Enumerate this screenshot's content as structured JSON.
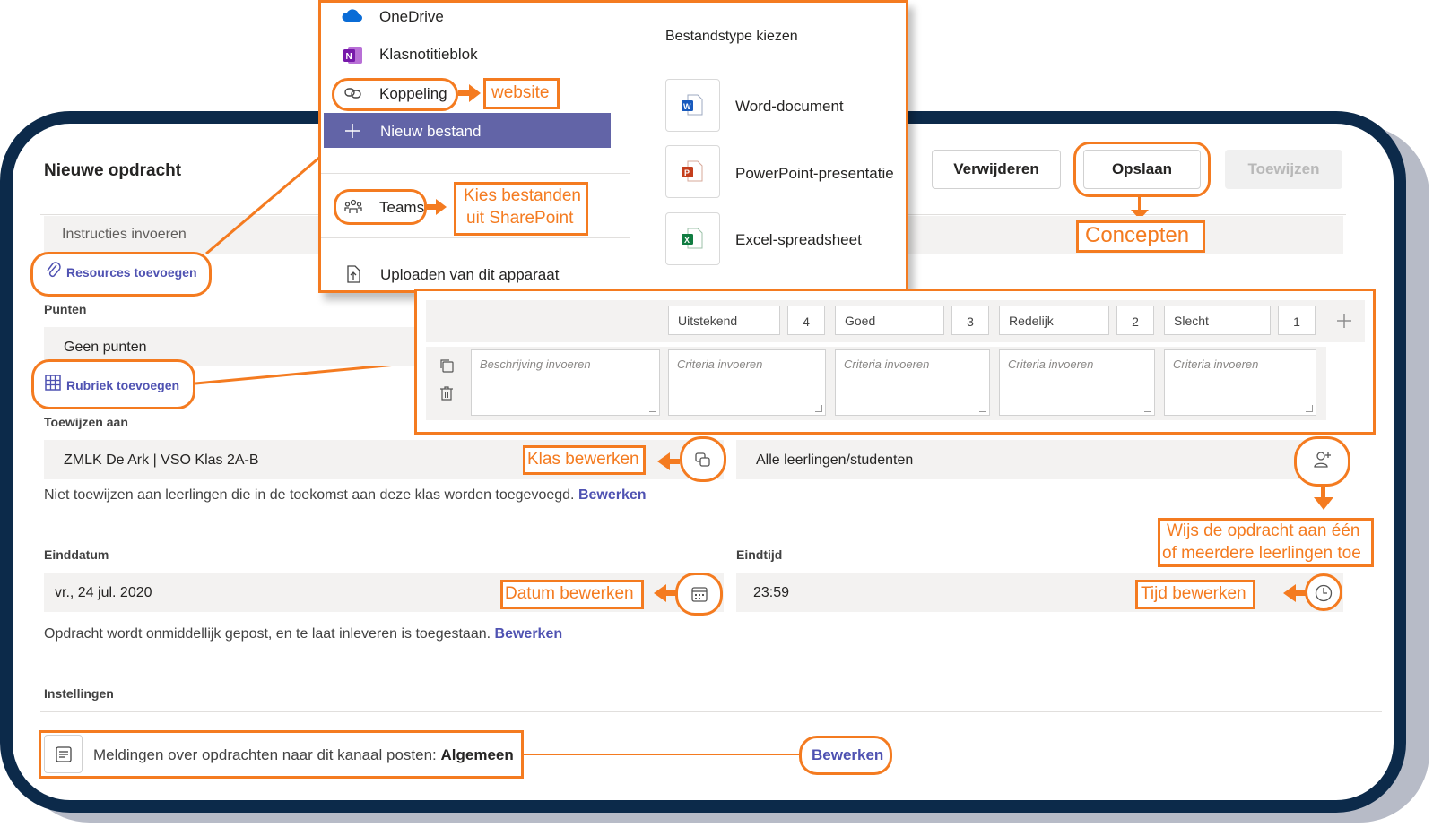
{
  "form": {
    "title": "Nieuwe opdracht",
    "instructions_placeholder": "Instructies invoeren",
    "resources_label": "Resources toevoegen",
    "points_label": "Punten",
    "points_value": "Geen punten",
    "rubric_label": "Rubriek toevoegen",
    "assign_to_label": "Toewijzen aan",
    "class_value": "ZMLK De Ark | VSO Klas 2A-B",
    "students_value": "Alle leerlingen/studenten",
    "future_note": "Niet toewijzen aan leerlingen die in de toekomst aan deze klas worden toegevoegd.",
    "future_edit": "Bewerken",
    "due_date_label": "Einddatum",
    "due_date_value": "vr., 24 jul. 2020",
    "due_time_label": "Eindtijd",
    "due_time_value": "23:59",
    "post_note": "Opdracht wordt onmiddellijk gepost, en te laat inleveren is toegestaan.",
    "post_edit": "Bewerken",
    "settings_label": "Instellingen",
    "channel_text": "Meldingen over opdrachten naar dit kanaal posten: ",
    "channel_name": "Algemeen",
    "channel_edit": "Bewerken"
  },
  "toolbar": {
    "delete_label": "Verwijderen",
    "save_label": "Opslaan",
    "assign_label": "Toewijzen"
  },
  "attach_menu": {
    "items": [
      {
        "label": "OneDrive",
        "icon": "onedrive-icon"
      },
      {
        "label": "Klasnotitieblok",
        "icon": "onenote-icon"
      },
      {
        "label": "Koppeling",
        "icon": "link-icon"
      },
      {
        "label": "Nieuw bestand",
        "icon": "plus-icon"
      },
      {
        "label": "Teams",
        "icon": "teams-icon"
      },
      {
        "label": "Uploaden van dit apparaat",
        "icon": "upload-icon"
      }
    ],
    "filetype_heading": "Bestandstype kiezen",
    "filetypes": [
      {
        "label": "Word-document",
        "icon": "word-icon"
      },
      {
        "label": "PowerPoint-presentatie",
        "icon": "powerpoint-icon"
      },
      {
        "label": "Excel-spreadsheet",
        "icon": "excel-icon"
      }
    ]
  },
  "rubric": {
    "levels": [
      {
        "name": "Uitstekend",
        "points": "4"
      },
      {
        "name": "Goed",
        "points": "3"
      },
      {
        "name": "Redelijk",
        "points": "2"
      },
      {
        "name": "Slecht",
        "points": "1"
      }
    ],
    "description_placeholder": "Beschrijving invoeren",
    "criteria_placeholder": "Criteria invoeren"
  },
  "annotations": {
    "website": "website",
    "sharepoint_line1": "Kies bestanden",
    "sharepoint_line2": "uit SharePoint",
    "concepts": "Concepten",
    "class_edit": "Klas bewerken",
    "assign_line1": "Wijs de opdracht aan één",
    "assign_line2": "of meerdere leerlingen toe",
    "date_edit": "Datum bewerken",
    "time_edit": "Tijd bewerken"
  },
  "colors": {
    "accent": "#f47b20",
    "brand": "#4f52b2",
    "frame": "#0c2a4a",
    "selected_menu": "#6264a7"
  }
}
